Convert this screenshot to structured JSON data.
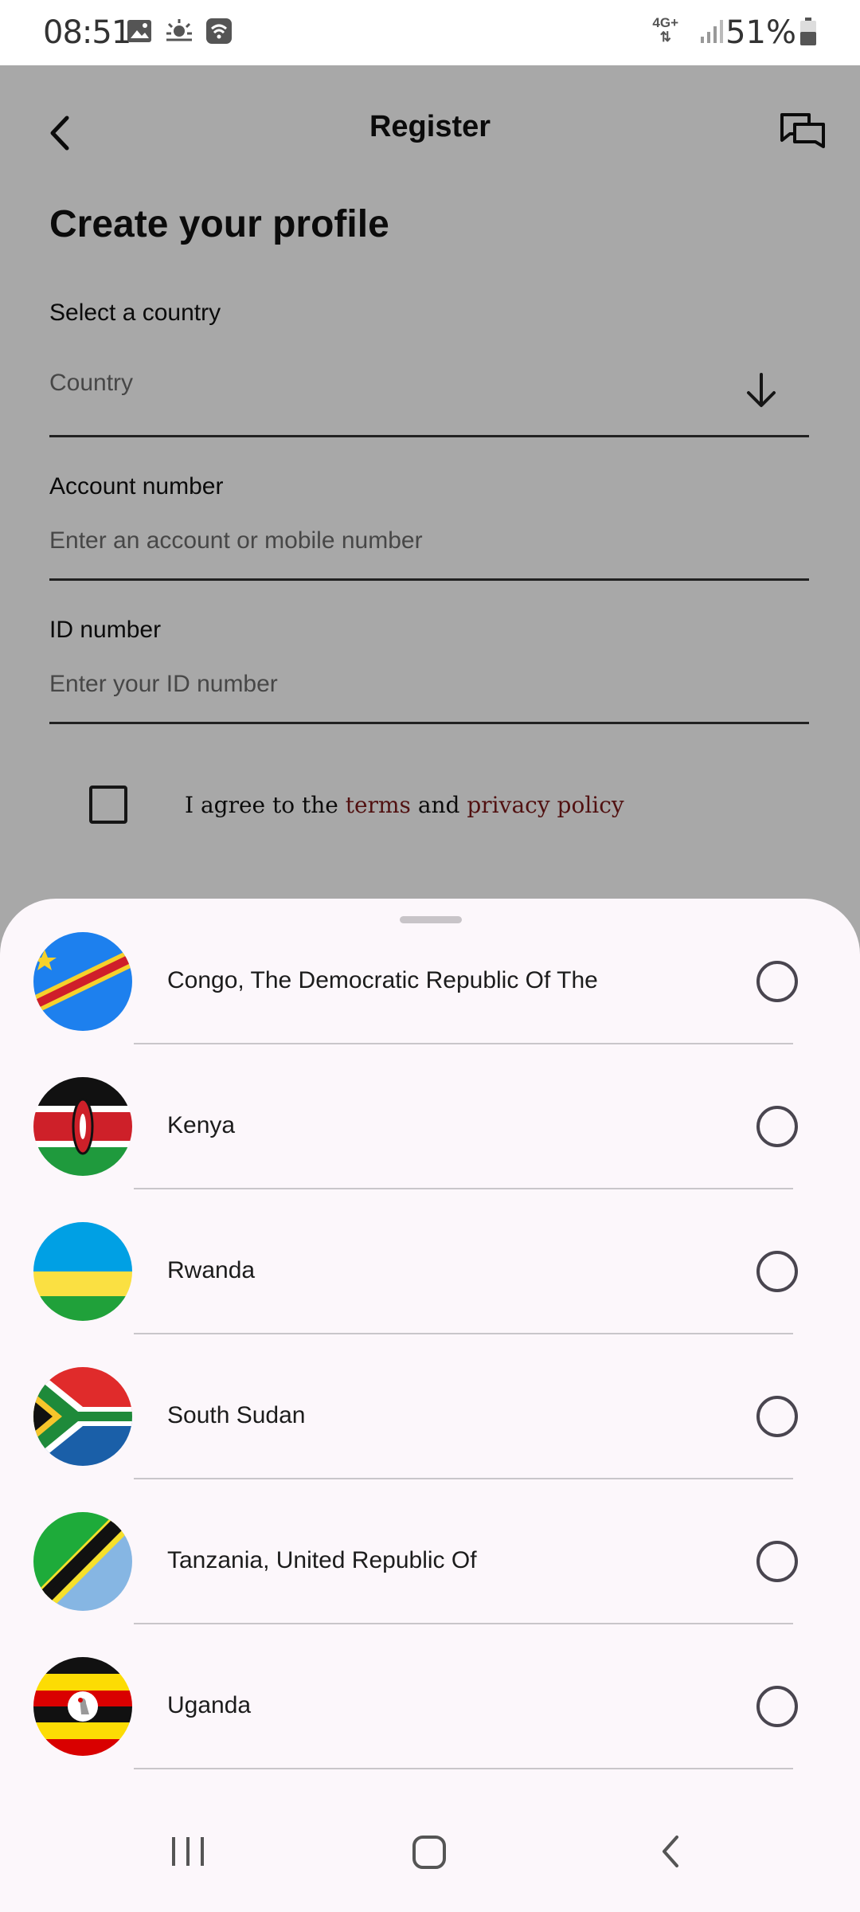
{
  "status_bar": {
    "time": "08:51",
    "network": "4G+",
    "battery": "51%",
    "icons": [
      "gallery-icon",
      "weather-icon",
      "wifi-calling-icon",
      "signal-icon",
      "battery-icon"
    ]
  },
  "header": {
    "title": "Register",
    "back_icon": "back-arrow-icon",
    "chat_icon": "chat-icon"
  },
  "form": {
    "heading": "Create your profile",
    "country_label": "Select a country",
    "country_placeholder": "Country",
    "account_label": "Account number",
    "account_placeholder": "Enter an account or mobile number",
    "id_label": "ID number",
    "id_placeholder": "Enter your ID number",
    "agree_prefix": "I agree to the ",
    "terms_link": "terms",
    "agree_middle": " and ",
    "privacy_link": "privacy policy",
    "link_color": "#7b1a1a"
  },
  "country_sheet": {
    "countries": [
      {
        "name": "Congo, The Democratic Republic Of The",
        "flag": "drc-flag-icon",
        "selected": false
      },
      {
        "name": "Kenya",
        "flag": "kenya-flag-icon",
        "selected": false
      },
      {
        "name": "Rwanda",
        "flag": "rwanda-flag-icon",
        "selected": false
      },
      {
        "name": "South Sudan",
        "flag": "south-africa-style-flag-icon",
        "selected": false
      },
      {
        "name": "Tanzania, United Republic Of",
        "flag": "tanzania-flag-icon",
        "selected": false
      },
      {
        "name": "Uganda",
        "flag": "uganda-flag-icon",
        "selected": false
      }
    ]
  },
  "nav_bar": {
    "items": [
      "recents-icon",
      "home-icon",
      "back-icon"
    ]
  }
}
